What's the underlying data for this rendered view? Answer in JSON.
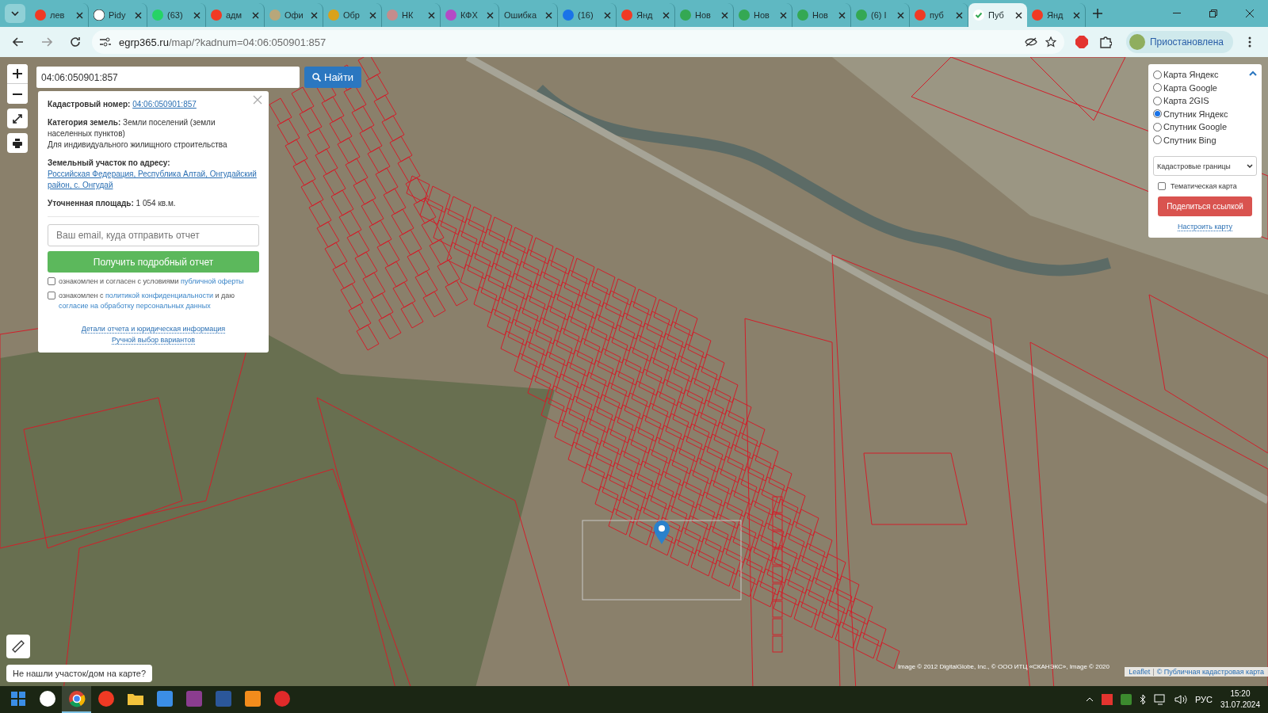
{
  "browser": {
    "tabs": [
      {
        "title": "лев",
        "kind": "yandex",
        "selected": false
      },
      {
        "title": "Pidy",
        "kind": "wiki",
        "selected": false
      },
      {
        "title": "(63)",
        "kind": "chat",
        "selected": false
      },
      {
        "title": "адм",
        "kind": "yandex",
        "selected": false
      },
      {
        "title": "Офи",
        "kind": "seal",
        "selected": false
      },
      {
        "title": "Обр",
        "kind": "emblem",
        "selected": false
      },
      {
        "title": "НК",
        "kind": "avatar",
        "selected": false
      },
      {
        "title": "КФХ",
        "kind": "podcast",
        "selected": false
      },
      {
        "title": "Ошибка",
        "kind": "plain",
        "selected": false
      },
      {
        "title": "(16)",
        "kind": "mail",
        "selected": false
      },
      {
        "title": "Янд",
        "kind": "yandex",
        "selected": false
      },
      {
        "title": "Нов",
        "kind": "house",
        "selected": false
      },
      {
        "title": "Нов",
        "kind": "house",
        "selected": false
      },
      {
        "title": "Нов",
        "kind": "house",
        "selected": false
      },
      {
        "title": "(6) I",
        "kind": "house",
        "selected": false
      },
      {
        "title": "пуб",
        "kind": "yandex",
        "selected": false
      },
      {
        "title": "Пуб",
        "kind": "check",
        "selected": true
      },
      {
        "title": "Янд",
        "kind": "yandex",
        "selected": false
      }
    ],
    "address": {
      "host": "egrp365.ru",
      "path": "/map/?kadnum=04:06:050901:857"
    },
    "profile": "Приостановлена"
  },
  "map": {
    "search": {
      "value": "04:06:050901:857",
      "button": "Найти"
    },
    "info": {
      "cadastral_label": "Кадастровый номер:",
      "cadastral_number": "04:06:050901:857",
      "category_label": "Категория земель:",
      "category": "Земли поселений (земли населенных пунктов)",
      "use": "Для индивидуального жилищного строительства",
      "address_label": "Земельный участок по адресу:",
      "address": "Российская Федерация, Республика Алтай, Онгудайский район, с. Онгудай",
      "area_label": "Уточненная площадь:",
      "area": "1 054 кв.м.",
      "email_placeholder": "Ваш email, куда отправить отчет",
      "report_button": "Получить подробный отчет",
      "agreements": [
        {
          "checked": false,
          "parts": [
            {
              "text": "ознакомлен и согласен с условиями ",
              "link": false
            },
            {
              "text": "публичной оферты",
              "link": true
            }
          ]
        },
        {
          "checked": false,
          "parts": [
            {
              "text": "ознакомлен с ",
              "link": false
            },
            {
              "text": "политикой конфиденциальности",
              "link": true
            },
            {
              "text": " и даю ",
              "link": false
            },
            {
              "text": "согласие на обработку персональных данных",
              "link": true
            }
          ]
        }
      ],
      "links": [
        "Детали отчета и юридическая информация",
        "Ручной выбор вариантов"
      ]
    },
    "layers": [
      {
        "label": "Карта Яндекс",
        "selected": false
      },
      {
        "label": "Карта Google",
        "selected": false
      },
      {
        "label": "Карта 2GIS",
        "selected": false
      },
      {
        "label": "Спутник Яндекс",
        "selected": true
      },
      {
        "label": "Спутник Google",
        "selected": false
      },
      {
        "label": "Спутник Bing",
        "selected": false
      }
    ],
    "overlay_select": "Кадастровые границы",
    "thematic": {
      "label": "Тематическая карта",
      "checked": false
    },
    "share_button": "Поделиться ссылкой",
    "settings_link": "Настроить карту",
    "help_tooltip": "Не нашли участок/дом на карте?",
    "imagery_credit": "Image © 2012 DigitalGlobe, Inc., © ООО ИТЦ «СКАНЭКС», Image © 2020",
    "attribution": {
      "leaflet": "Leaflet",
      "separator": "|",
      "source": "© Публичная кадастровая карта"
    }
  },
  "taskbar": {
    "apps": [
      {
        "kind": "start",
        "active": false
      },
      {
        "kind": "browser-y",
        "active": false
      },
      {
        "kind": "chrome",
        "active": true
      },
      {
        "kind": "yandex",
        "active": false
      },
      {
        "kind": "folder",
        "active": false
      },
      {
        "kind": "photos",
        "active": false
      },
      {
        "kind": "archive",
        "active": false
      },
      {
        "kind": "word",
        "active": false
      },
      {
        "kind": "orange",
        "active": false
      },
      {
        "kind": "reader",
        "active": false
      }
    ],
    "language": "РУС",
    "time": "15:20",
    "date": "31.07.2024"
  }
}
